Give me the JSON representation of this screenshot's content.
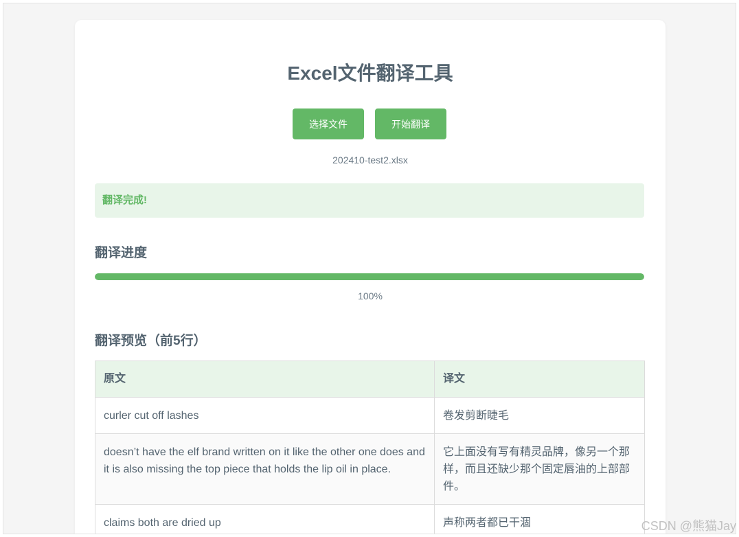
{
  "app": {
    "title": "Excel文件翻译工具"
  },
  "toolbar": {
    "select_label": "选择文件",
    "start_label": "开始翻译"
  },
  "file": {
    "name": "202410-test2.xlsx"
  },
  "status": {
    "message": "翻译完成!"
  },
  "progress": {
    "title": "翻译进度",
    "percent": 100,
    "label": "100%"
  },
  "preview": {
    "title": "翻译预览（前5行）",
    "headers": [
      "原文",
      "译文"
    ],
    "rows": [
      [
        "curler cut off lashes",
        "卷发剪断睫毛"
      ],
      [
        "doesn’t have the elf brand written on it like the other one does and it is also missing the top piece that holds the lip oil in place.",
        "它上面没有写有精灵品牌，像另一个那样，而且还缺少那个固定唇油的上部部件。"
      ],
      [
        "claims both are dried up",
        "声称两者都已干涸"
      ]
    ]
  },
  "watermark": "CSDN @熊猫Jay",
  "colors": {
    "accent": "#63b866",
    "status_bg": "#e8f5e9",
    "text": "#546470",
    "background": "#f5f5f5"
  }
}
